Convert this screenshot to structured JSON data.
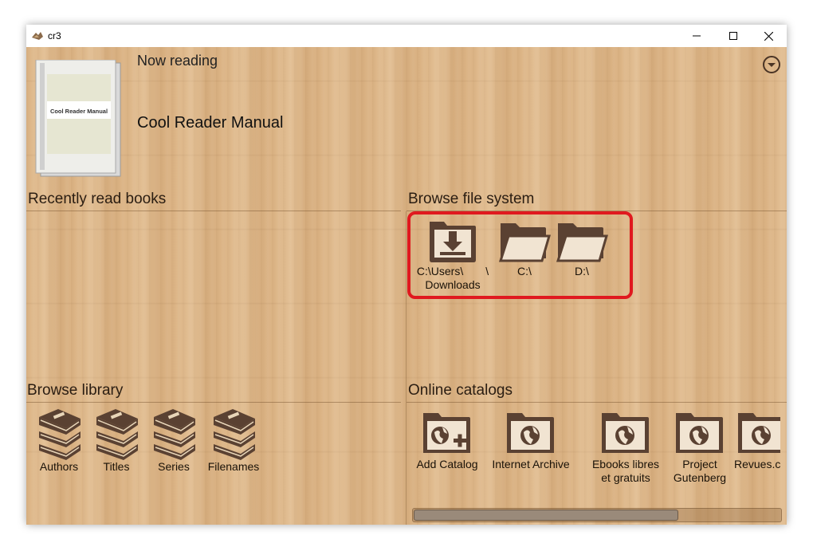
{
  "window": {
    "title": "cr3"
  },
  "now_reading": {
    "label": "Now reading",
    "book_title": "Cool Reader Manual",
    "cover_text": "Cool Reader Manual"
  },
  "sections": {
    "recent": "Recently read books",
    "filesystem": "Browse file system",
    "library": "Browse library",
    "catalogs": "Online catalogs"
  },
  "filesystem_items": [
    {
      "label": "C:\\Users\\  \\\nDownloads",
      "icon": "download-folder-icon"
    },
    {
      "label": "C:\\",
      "icon": "folder-icon"
    },
    {
      "label": "D:\\",
      "icon": "folder-icon"
    }
  ],
  "library_items": [
    {
      "label": "Authors",
      "icon": "books-stack-icon"
    },
    {
      "label": "Titles",
      "icon": "books-stack-icon"
    },
    {
      "label": "Series",
      "icon": "books-stack-icon"
    },
    {
      "label": "Filenames",
      "icon": "books-stack-icon"
    }
  ],
  "catalog_items": [
    {
      "label": "Add Catalog",
      "icon": "add-catalog-icon"
    },
    {
      "label": "Internet Archive",
      "icon": "globe-folder-icon"
    },
    {
      "label": "Ebooks libres\net gratuits",
      "icon": "globe-folder-icon"
    },
    {
      "label": "Project\nGutenberg",
      "icon": "globe-folder-icon"
    },
    {
      "label": "Revues.c",
      "icon": "globe-folder-icon"
    }
  ],
  "catalog_scroll": {
    "position": 0.0,
    "visible_fraction": 0.72
  },
  "colors": {
    "accent_highlight": "#e0191f",
    "icon_brown": "#5a4132",
    "wood": "#dcb485"
  }
}
